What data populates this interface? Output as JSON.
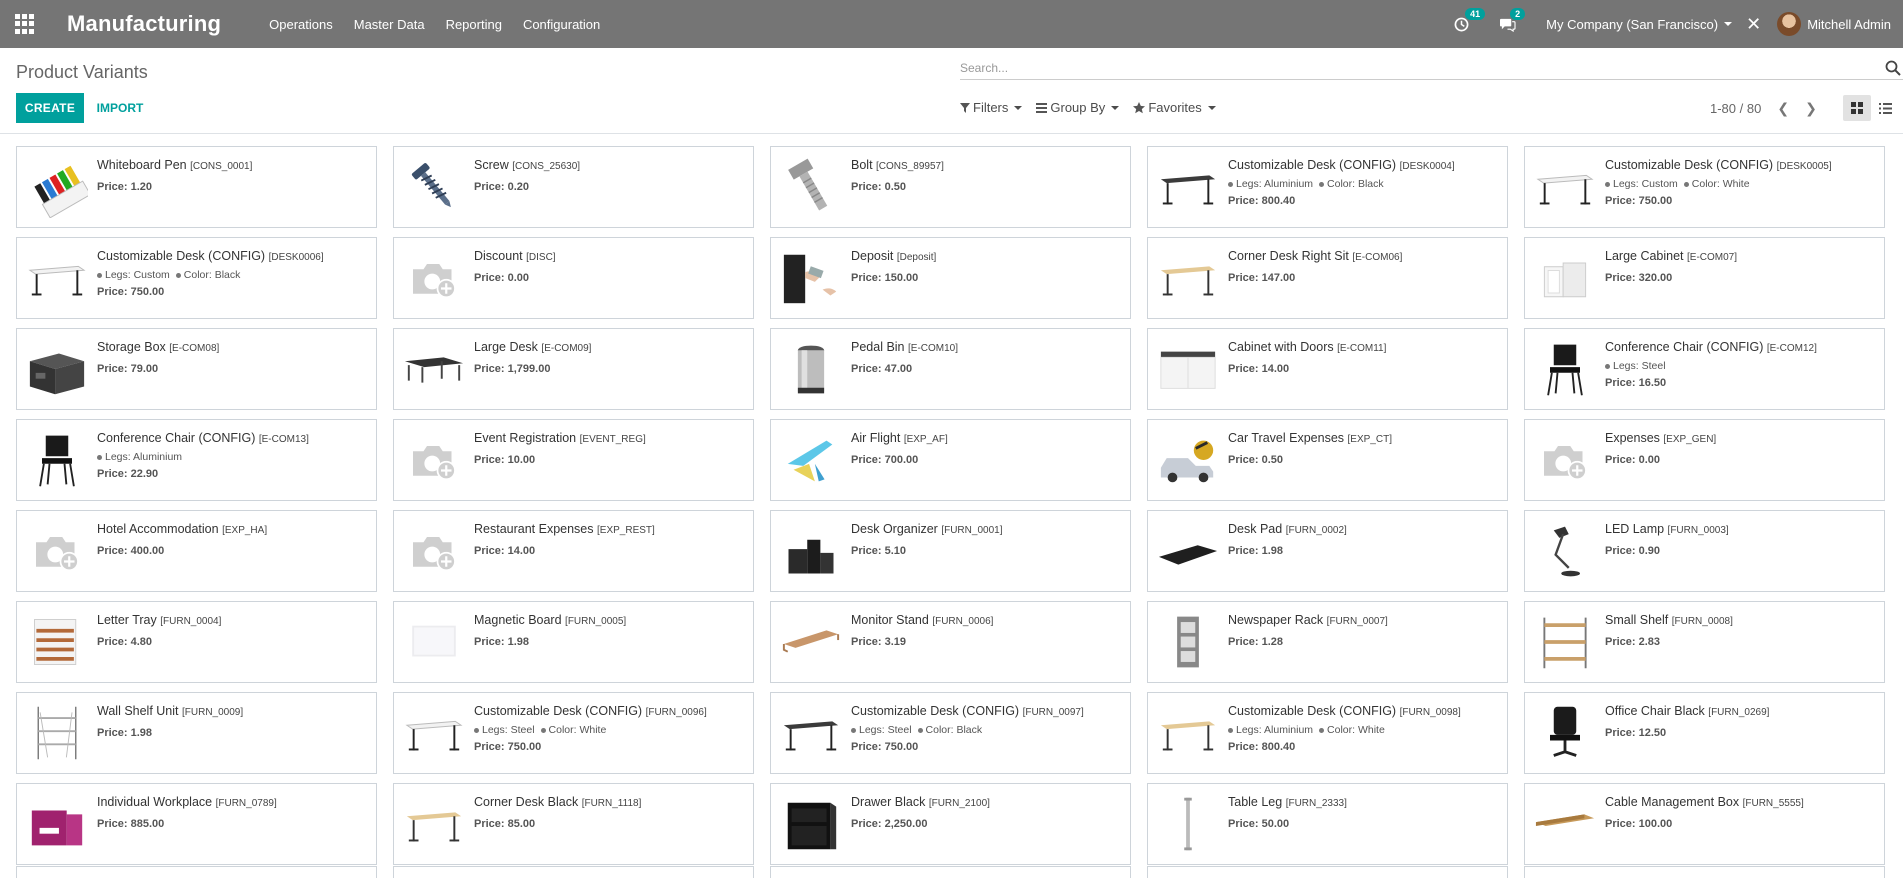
{
  "navbar": {
    "app_name": "Manufacturing",
    "menu": [
      "Operations",
      "Master Data",
      "Reporting",
      "Configuration"
    ],
    "activity_count": "41",
    "message_count": "2",
    "company": "My Company (San Francisco)",
    "user": "Mitchell Admin"
  },
  "control": {
    "breadcrumb": "Product Variants",
    "create_label": "CREATE",
    "import_label": "IMPORT",
    "search_placeholder": "Search...",
    "filters_label": "Filters",
    "groupby_label": "Group By",
    "favorites_label": "Favorites",
    "pager": "1-80 / 80"
  },
  "colors": {
    "brand": "#00a09d",
    "navbar": "#757575"
  },
  "cards": [
    {
      "name": "Whiteboard Pen",
      "ref": "[CONS_0001]",
      "attrs": [],
      "price": "Price: 1.20",
      "icon": "whiteboard-pen"
    },
    {
      "name": "Screw",
      "ref": "[CONS_25630]",
      "attrs": [],
      "price": "Price: 0.20",
      "icon": "screw"
    },
    {
      "name": "Bolt",
      "ref": "[CONS_89957]",
      "attrs": [],
      "price": "Price: 0.50",
      "icon": "bolt"
    },
    {
      "name": "Customizable Desk (CONFIG)",
      "ref": "[DESK0004]",
      "attrs": [
        "Legs: Aluminium",
        "Color: Black"
      ],
      "price": "Price: 800.40",
      "icon": "desk-black"
    },
    {
      "name": "Customizable Desk (CONFIG)",
      "ref": "[DESK0005]",
      "attrs": [
        "Legs: Custom",
        "Color: White"
      ],
      "price": "Price: 750.00",
      "icon": "desk-white"
    },
    {
      "name": "Customizable Desk (CONFIG)",
      "ref": "[DESK0006]",
      "attrs": [
        "Legs: Custom",
        "Color: Black"
      ],
      "price": "Price: 750.00",
      "icon": "desk-white"
    },
    {
      "name": "Discount",
      "ref": "[DISC]",
      "attrs": [],
      "price": "Price: 0.00",
      "icon": "placeholder"
    },
    {
      "name": "Deposit",
      "ref": "[Deposit]",
      "attrs": [],
      "price": "Price: 150.00",
      "icon": "deposit"
    },
    {
      "name": "Corner Desk Right Sit",
      "ref": "[E-COM06]",
      "attrs": [],
      "price": "Price: 147.00",
      "icon": "desk-wood"
    },
    {
      "name": "Large Cabinet",
      "ref": "[E-COM07]",
      "attrs": [],
      "price": "Price: 320.00",
      "icon": "cabinet"
    },
    {
      "name": "Storage Box",
      "ref": "[E-COM08]",
      "attrs": [],
      "price": "Price: 79.00",
      "icon": "storage-box"
    },
    {
      "name": "Large Desk",
      "ref": "[E-COM09]",
      "attrs": [],
      "price": "Price: 1,799.00",
      "icon": "large-desk"
    },
    {
      "name": "Pedal Bin",
      "ref": "[E-COM10]",
      "attrs": [],
      "price": "Price: 47.00",
      "icon": "pedal-bin"
    },
    {
      "name": "Cabinet with Doors",
      "ref": "[E-COM11]",
      "attrs": [],
      "price": "Price: 14.00",
      "icon": "cabinet-doors"
    },
    {
      "name": "Conference Chair (CONFIG)",
      "ref": "[E-COM12]",
      "attrs": [
        "Legs: Steel"
      ],
      "price": "Price: 16.50",
      "icon": "chair"
    },
    {
      "name": "Conference Chair (CONFIG)",
      "ref": "[E-COM13]",
      "attrs": [
        "Legs: Aluminium"
      ],
      "price": "Price: 22.90",
      "icon": "chair"
    },
    {
      "name": "Event Registration",
      "ref": "[EVENT_REG]",
      "attrs": [],
      "price": "Price: 10.00",
      "icon": "placeholder"
    },
    {
      "name": "Air Flight",
      "ref": "[EXP_AF]",
      "attrs": [],
      "price": "Price: 700.00",
      "icon": "air-flight"
    },
    {
      "name": "Car Travel Expenses",
      "ref": "[EXP_CT]",
      "attrs": [],
      "price": "Price: 0.50",
      "icon": "car"
    },
    {
      "name": "Expenses",
      "ref": "[EXP_GEN]",
      "attrs": [],
      "price": "Price: 0.00",
      "icon": "placeholder"
    },
    {
      "name": "Hotel Accommodation",
      "ref": "[EXP_HA]",
      "attrs": [],
      "price": "Price: 400.00",
      "icon": "placeholder"
    },
    {
      "name": "Restaurant Expenses",
      "ref": "[EXP_REST]",
      "attrs": [],
      "price": "Price: 14.00",
      "icon": "placeholder"
    },
    {
      "name": "Desk Organizer",
      "ref": "[FURN_0001]",
      "attrs": [],
      "price": "Price: 5.10",
      "icon": "desk-organizer"
    },
    {
      "name": "Desk Pad",
      "ref": "[FURN_0002]",
      "attrs": [],
      "price": "Price: 1.98",
      "icon": "desk-pad"
    },
    {
      "name": "LED Lamp",
      "ref": "[FURN_0003]",
      "attrs": [],
      "price": "Price: 0.90",
      "icon": "lamp"
    },
    {
      "name": "Letter Tray",
      "ref": "[FURN_0004]",
      "attrs": [],
      "price": "Price: 4.80",
      "icon": "letter-tray"
    },
    {
      "name": "Magnetic Board",
      "ref": "[FURN_0005]",
      "attrs": [],
      "price": "Price: 1.98",
      "icon": "magnetic-board"
    },
    {
      "name": "Monitor Stand",
      "ref": "[FURN_0006]",
      "attrs": [],
      "price": "Price: 3.19",
      "icon": "monitor-stand"
    },
    {
      "name": "Newspaper Rack",
      "ref": "[FURN_0007]",
      "attrs": [],
      "price": "Price: 1.28",
      "icon": "newspaper-rack"
    },
    {
      "name": "Small Shelf",
      "ref": "[FURN_0008]",
      "attrs": [],
      "price": "Price: 2.83",
      "icon": "shelf"
    },
    {
      "name": "Wall Shelf Unit",
      "ref": "[FURN_0009]",
      "attrs": [],
      "price": "Price: 1.98",
      "icon": "wall-shelf"
    },
    {
      "name": "Customizable Desk (CONFIG)",
      "ref": "[FURN_0096]",
      "attrs": [
        "Legs: Steel",
        "Color: White"
      ],
      "price": "Price: 750.00",
      "icon": "desk-white"
    },
    {
      "name": "Customizable Desk (CONFIG)",
      "ref": "[FURN_0097]",
      "attrs": [
        "Legs: Steel",
        "Color: Black"
      ],
      "price": "Price: 750.00",
      "icon": "desk-black"
    },
    {
      "name": "Customizable Desk (CONFIG)",
      "ref": "[FURN_0098]",
      "attrs": [
        "Legs: Aluminium",
        "Color: White"
      ],
      "price": "Price: 800.40",
      "icon": "desk-wood"
    },
    {
      "name": "Office Chair Black",
      "ref": "[FURN_0269]",
      "attrs": [],
      "price": "Price: 12.50",
      "icon": "office-chair"
    },
    {
      "name": "Individual Workplace",
      "ref": "[FURN_0789]",
      "attrs": [],
      "price": "Price: 885.00",
      "icon": "workplace"
    },
    {
      "name": "Corner Desk Black",
      "ref": "[FURN_1118]",
      "attrs": [],
      "price": "Price: 85.00",
      "icon": "desk-wood"
    },
    {
      "name": "Drawer Black",
      "ref": "[FURN_2100]",
      "attrs": [],
      "price": "Price: 2,250.00",
      "icon": "drawer"
    },
    {
      "name": "Table Leg",
      "ref": "[FURN_2333]",
      "attrs": [],
      "price": "Price: 50.00",
      "icon": "table-leg"
    },
    {
      "name": "Cable Management Box",
      "ref": "[FURN_5555]",
      "attrs": [],
      "price": "Price: 100.00",
      "icon": "cable-box"
    }
  ]
}
